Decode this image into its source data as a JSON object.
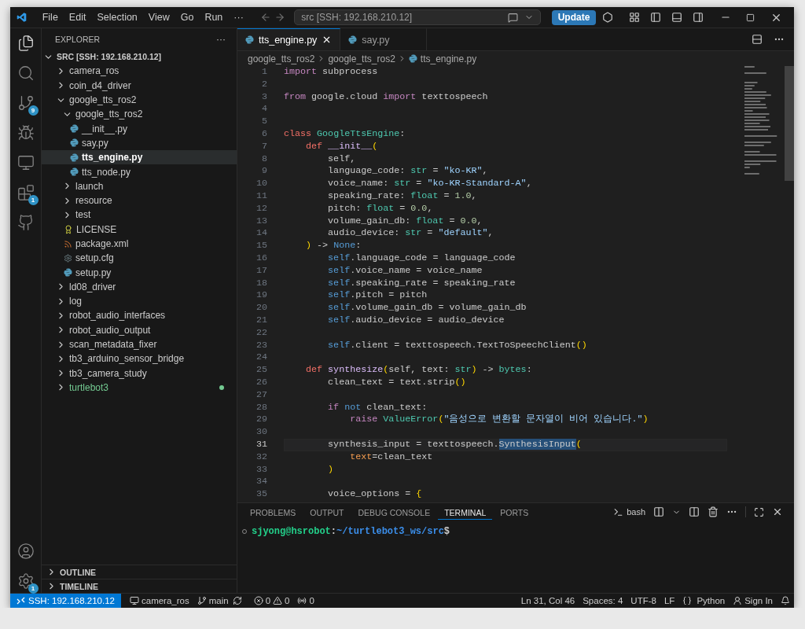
{
  "title_bar": {
    "menus": [
      "File",
      "Edit",
      "Selection",
      "View",
      "Go",
      "Run"
    ],
    "more": "···",
    "command_center": "src [SSH: 192.168.210.12]",
    "update_button": "Update"
  },
  "activity_bar": {
    "top": [
      {
        "selected": true
      },
      {
        "selected": false
      },
      {
        "selected": false,
        "badge": "9"
      },
      {
        "selected": false
      },
      {
        "selected": false
      },
      {
        "selected": false,
        "badge": "1"
      },
      {
        "selected": false
      }
    ],
    "bottom": [
      {
        "selected": false
      },
      {
        "selected": false,
        "badge": "1"
      }
    ]
  },
  "sidebar": {
    "title": "EXPLORER",
    "more": "···",
    "root": {
      "label": "SRC [SSH: 192.168.210.12]",
      "expanded": true
    },
    "tree": [
      {
        "label": "camera_ros",
        "kind": "folder",
        "expanded": false,
        "selected": false
      },
      {
        "label": "coin_d4_driver",
        "kind": "folder",
        "expanded": false,
        "selected": false
      },
      {
        "label": "google_tts_ros2",
        "kind": "folder",
        "expanded": true,
        "selected": false,
        "children": [
          {
            "label": "google_tts_ros2",
            "kind": "folder",
            "expanded": true,
            "selected": false,
            "children": [
              {
                "label": "__init__.py",
                "kind": "python",
                "selected": false
              },
              {
                "label": "say.py",
                "kind": "python",
                "selected": false
              },
              {
                "label": "tts_engine.py",
                "kind": "python",
                "selected": true
              },
              {
                "label": "tts_node.py",
                "kind": "python",
                "selected": false
              }
            ]
          },
          {
            "label": "launch",
            "kind": "folder",
            "expanded": false,
            "selected": false
          },
          {
            "label": "resource",
            "kind": "folder",
            "expanded": false,
            "selected": false
          },
          {
            "label": "test",
            "kind": "folder",
            "expanded": false,
            "selected": false
          },
          {
            "label": "LICENSE",
            "kind": "license",
            "selected": false
          },
          {
            "label": "package.xml",
            "kind": "xml",
            "selected": false
          },
          {
            "label": "setup.cfg",
            "kind": "config",
            "selected": false
          },
          {
            "label": "setup.py",
            "kind": "python",
            "selected": false
          }
        ]
      },
      {
        "label": "ld08_driver",
        "kind": "folder",
        "expanded": false,
        "selected": false
      },
      {
        "label": "log",
        "kind": "folder",
        "expanded": false,
        "selected": false
      },
      {
        "label": "robot_audio_interfaces",
        "kind": "folder",
        "expanded": false,
        "selected": false
      },
      {
        "label": "robot_audio_output",
        "kind": "folder",
        "expanded": false,
        "selected": false
      },
      {
        "label": "scan_metadata_fixer",
        "kind": "folder",
        "expanded": false,
        "selected": false
      },
      {
        "label": "tb3_arduino_sensor_bridge",
        "kind": "folder",
        "expanded": false,
        "selected": false
      },
      {
        "label": "tb3_camera_study",
        "kind": "folder",
        "expanded": false,
        "selected": false
      },
      {
        "label": "turtlebot3",
        "kind": "folder",
        "expanded": false,
        "selected": false,
        "color": "#73c991"
      }
    ],
    "sections": [
      {
        "label": "OUTLINE",
        "expanded": false
      },
      {
        "label": "TIMELINE",
        "expanded": false
      }
    ]
  },
  "editor": {
    "tabs": [
      {
        "label": "tts_engine.py",
        "selected": true
      },
      {
        "label": "say.py",
        "selected": false
      }
    ],
    "breadcrumbs": [
      "google_tts_ros2",
      "google_tts_ros2",
      "tts_engine.py"
    ],
    "lines": [
      {
        "number": "1",
        "current": false,
        "tokens": [
          {
            "text": "import",
            "kind": "keyword"
          },
          {
            "text": " subprocess",
            "kind": "plain"
          }
        ]
      },
      {
        "number": "2",
        "current": false
      },
      {
        "number": "3",
        "current": false,
        "tokens": [
          {
            "text": "from",
            "kind": "keyword"
          },
          {
            "text": " google.cloud ",
            "kind": "plain"
          },
          {
            "text": "import",
            "kind": "keyword"
          },
          {
            "text": " texttospeech",
            "kind": "plain"
          }
        ]
      },
      {
        "number": "4",
        "current": false
      },
      {
        "number": "5",
        "current": false
      },
      {
        "number": "6",
        "current": false,
        "tokens": [
          {
            "text": "class ",
            "kind": "storage"
          },
          {
            "text": "GoogleTtsEngine",
            "kind": "class"
          },
          {
            "text": ":",
            "kind": "plain"
          }
        ]
      },
      {
        "number": "7",
        "current": false,
        "tokens": [
          {
            "text": "    def ",
            "kind": "storage"
          },
          {
            "text": "__init__",
            "kind": "function"
          },
          {
            "text": "(",
            "kind": "bracket"
          }
        ]
      },
      {
        "number": "8",
        "current": false,
        "tokens": [
          {
            "text": "        self,",
            "kind": "plain"
          }
        ]
      },
      {
        "number": "9",
        "current": false,
        "tokens": [
          {
            "text": "        language_code: ",
            "kind": "plain"
          },
          {
            "text": "str",
            "kind": "type"
          },
          {
            "text": " = ",
            "kind": "plain"
          },
          {
            "text": "\"ko-KR\"",
            "kind": "string"
          },
          {
            "text": ",",
            "kind": "plain"
          }
        ]
      },
      {
        "number": "10",
        "current": false,
        "tokens": [
          {
            "text": "        voice_name: ",
            "kind": "plain"
          },
          {
            "text": "str",
            "kind": "type"
          },
          {
            "text": " = ",
            "kind": "plain"
          },
          {
            "text": "\"ko-KR-Standard-A\"",
            "kind": "string"
          },
          {
            "text": ",",
            "kind": "plain"
          }
        ]
      },
      {
        "number": "11",
        "current": false,
        "tokens": [
          {
            "text": "        speaking_rate: ",
            "kind": "plain"
          },
          {
            "text": "float",
            "kind": "type"
          },
          {
            "text": " = ",
            "kind": "plain"
          },
          {
            "text": "1.0",
            "kind": "number"
          },
          {
            "text": ",",
            "kind": "plain"
          }
        ]
      },
      {
        "number": "12",
        "current": false,
        "tokens": [
          {
            "text": "        pitch: ",
            "kind": "plain"
          },
          {
            "text": "float",
            "kind": "type"
          },
          {
            "text": " = ",
            "kind": "plain"
          },
          {
            "text": "0.0",
            "kind": "number"
          },
          {
            "text": ",",
            "kind": "plain"
          }
        ]
      },
      {
        "number": "13",
        "current": false,
        "tokens": [
          {
            "text": "        volume_gain_db: ",
            "kind": "plain"
          },
          {
            "text": "float",
            "kind": "type"
          },
          {
            "text": " = ",
            "kind": "plain"
          },
          {
            "text": "0.0",
            "kind": "number"
          },
          {
            "text": ",",
            "kind": "plain"
          }
        ]
      },
      {
        "number": "14",
        "current": false,
        "tokens": [
          {
            "text": "        audio_device: ",
            "kind": "plain"
          },
          {
            "text": "str",
            "kind": "type"
          },
          {
            "text": " = ",
            "kind": "plain"
          },
          {
            "text": "\"default\"",
            "kind": "string"
          },
          {
            "text": ",",
            "kind": "plain"
          }
        ]
      },
      {
        "number": "15",
        "current": false,
        "tokens": [
          {
            "text": "    )",
            "kind": "bracket"
          },
          {
            "text": " -> ",
            "kind": "plain"
          },
          {
            "text": "None",
            "kind": "builtin"
          },
          {
            "text": ":",
            "kind": "plain"
          }
        ]
      },
      {
        "number": "16",
        "current": false,
        "tokens": [
          {
            "text": "        self",
            "kind": "builtin"
          },
          {
            "text": ".language_code = language_code",
            "kind": "plain"
          }
        ]
      },
      {
        "number": "17",
        "current": false,
        "tokens": [
          {
            "text": "        self",
            "kind": "builtin"
          },
          {
            "text": ".voice_name = voice_name",
            "kind": "plain"
          }
        ]
      },
      {
        "number": "18",
        "current": false,
        "tokens": [
          {
            "text": "        self",
            "kind": "builtin"
          },
          {
            "text": ".speaking_rate = speaking_rate",
            "kind": "plain"
          }
        ]
      },
      {
        "number": "19",
        "current": false,
        "tokens": [
          {
            "text": "        self",
            "kind": "builtin"
          },
          {
            "text": ".pitch = pitch",
            "kind": "plain"
          }
        ]
      },
      {
        "number": "20",
        "current": false,
        "tokens": [
          {
            "text": "        self",
            "kind": "builtin"
          },
          {
            "text": ".volume_gain_db = volume_gain_db",
            "kind": "plain"
          }
        ]
      },
      {
        "number": "21",
        "current": false,
        "tokens": [
          {
            "text": "        self",
            "kind": "builtin"
          },
          {
            "text": ".audio_device = audio_device",
            "kind": "plain"
          }
        ]
      },
      {
        "number": "22",
        "current": false
      },
      {
        "number": "23",
        "current": false,
        "tokens": [
          {
            "text": "        self",
            "kind": "builtin"
          },
          {
            "text": ".client = texttospeech.TextToSpeechClient",
            "kind": "plain"
          },
          {
            "text": "()",
            "kind": "bracket"
          }
        ]
      },
      {
        "number": "24",
        "current": false
      },
      {
        "number": "25",
        "current": false,
        "tokens": [
          {
            "text": "    def ",
            "kind": "storage"
          },
          {
            "text": "synthesize",
            "kind": "function"
          },
          {
            "text": "(",
            "kind": "bracket"
          },
          {
            "text": "self, text: ",
            "kind": "plain"
          },
          {
            "text": "str",
            "kind": "type"
          },
          {
            "text": ")",
            "kind": "bracket"
          },
          {
            "text": " -> ",
            "kind": "plain"
          },
          {
            "text": "bytes",
            "kind": "type"
          },
          {
            "text": ":",
            "kind": "plain"
          }
        ]
      },
      {
        "number": "26",
        "current": false,
        "tokens": [
          {
            "text": "        clean_text = text.strip",
            "kind": "plain"
          },
          {
            "text": "()",
            "kind": "bracket"
          }
        ]
      },
      {
        "number": "27",
        "current": false
      },
      {
        "number": "28",
        "current": false,
        "tokens": [
          {
            "text": "        if ",
            "kind": "keyword"
          },
          {
            "text": "not",
            "kind": "builtin"
          },
          {
            "text": " clean_text:",
            "kind": "plain"
          }
        ]
      },
      {
        "number": "29",
        "current": false,
        "tokens": [
          {
            "text": "            raise ",
            "kind": "keyword"
          },
          {
            "text": "ValueError",
            "kind": "class"
          },
          {
            "text": "(",
            "kind": "bracket"
          },
          {
            "text": "\"음성으로 변환할 문자열이 비어 있습니다.\"",
            "kind": "string"
          },
          {
            "text": ")",
            "kind": "bracket"
          }
        ]
      },
      {
        "number": "30",
        "current": false
      },
      {
        "number": "31",
        "current": true,
        "tokens": [
          {
            "text": "        synthesis_input = texttospeech.",
            "kind": "plain"
          },
          {
            "text": "SynthesisInput",
            "kind": "match"
          },
          {
            "text": "(",
            "kind": "bracket"
          }
        ]
      },
      {
        "number": "32",
        "current": false,
        "tokens": [
          {
            "text": "            text",
            "kind": "parameter"
          },
          {
            "text": "=clean_text",
            "kind": "plain"
          }
        ]
      },
      {
        "number": "33",
        "current": false,
        "tokens": [
          {
            "text": "        )",
            "kind": "bracket"
          }
        ]
      },
      {
        "number": "34",
        "current": false
      },
      {
        "number": "35",
        "current": false,
        "tokens": [
          {
            "text": "        voice_options = ",
            "kind": "plain"
          },
          {
            "text": "{",
            "kind": "bracket"
          }
        ]
      }
    ]
  },
  "panel": {
    "tabs": [
      {
        "label": "PROBLEMS",
        "selected": false
      },
      {
        "label": "OUTPUT",
        "selected": false
      },
      {
        "label": "DEBUG CONSOLE",
        "selected": false
      },
      {
        "label": "TERMINAL",
        "selected": true
      },
      {
        "label": "PORTS",
        "selected": false
      }
    ],
    "shell": "bash",
    "prompt": {
      "user": "sjyong@hsrobot",
      "separator": ":",
      "path": "~/turtlebot3_ws/src",
      "symbol": "$"
    }
  },
  "status_bar": {
    "remote": "SSH: 192.168.210.12",
    "project": "camera_ros",
    "branch": "main",
    "errors": "0",
    "warnings": "0",
    "ports": "0",
    "position": "Ln 31, Col 46",
    "indentation": "Spaces: 4",
    "encoding": "UTF-8",
    "eol": "LF",
    "language": "Python",
    "account": "Sign In"
  }
}
